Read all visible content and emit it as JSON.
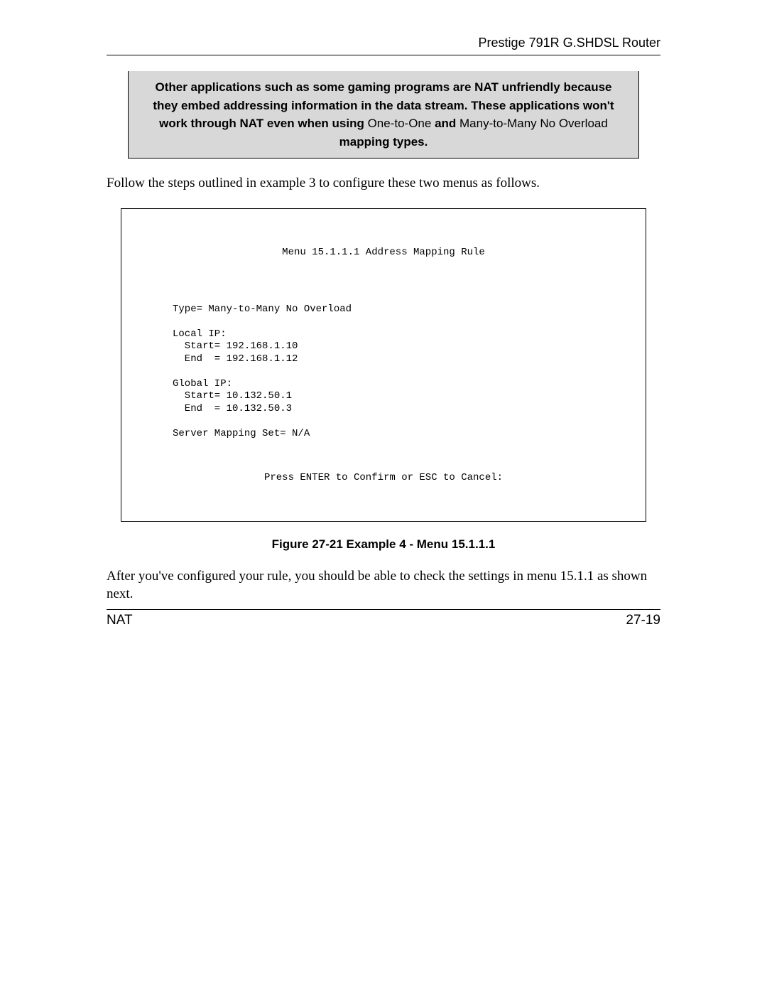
{
  "header": {
    "title": "Prestige 791R G.SHDSL Router"
  },
  "callout": {
    "line1_bold": "Other applications such as some gaming programs are NAT unfriendly because they embed addressing information in the data stream. These applications won't work through NAT even when using ",
    "term1": "One-to-One",
    "mid_bold": " and ",
    "term2": "Many-to-Many No Overload",
    "end_bold": " mapping types."
  },
  "para1": "Follow the steps outlined in example 3 to configure these two menus as follows.",
  "terminal": {
    "title": "Menu 15.1.1.1 Address Mapping Rule",
    "type_line": "Type= Many-to-Many No Overload",
    "local_label": "Local IP:",
    "local_start": "  Start= 192.168.1.10",
    "local_end": "  End  = 192.168.1.12",
    "global_label": "Global IP:",
    "global_start": "  Start= 10.132.50.1",
    "global_end": "  End  = 10.132.50.3",
    "server_line": "Server Mapping Set= N/A",
    "footer": "Press ENTER to Confirm or ESC to Cancel:"
  },
  "figure_caption": "Figure 27-21 Example 4 - Menu 15.1.1.1",
  "para2": "After you've configured your rule, you should be able to check the settings in menu 15.1.1 as shown next.",
  "footer": {
    "left": "NAT",
    "right": "27-19"
  }
}
